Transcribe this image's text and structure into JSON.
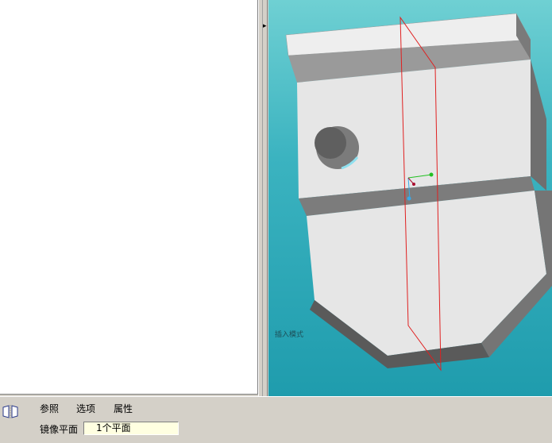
{
  "viewport": {
    "mode_label": "插入模式"
  },
  "dashboard": {
    "tabs": [
      {
        "label": "参照"
      },
      {
        "label": "选项"
      },
      {
        "label": "属性"
      }
    ],
    "field_label": "镜像平面",
    "field_value": "1个平面",
    "icon": "mirror-icon"
  },
  "colors": {
    "viewport_top": "#6fd0d3",
    "viewport_bottom": "#1f9cad",
    "datum_plane": "#e02020",
    "part_face": "#e6e6e6",
    "field_bg": "#ffffe1"
  }
}
